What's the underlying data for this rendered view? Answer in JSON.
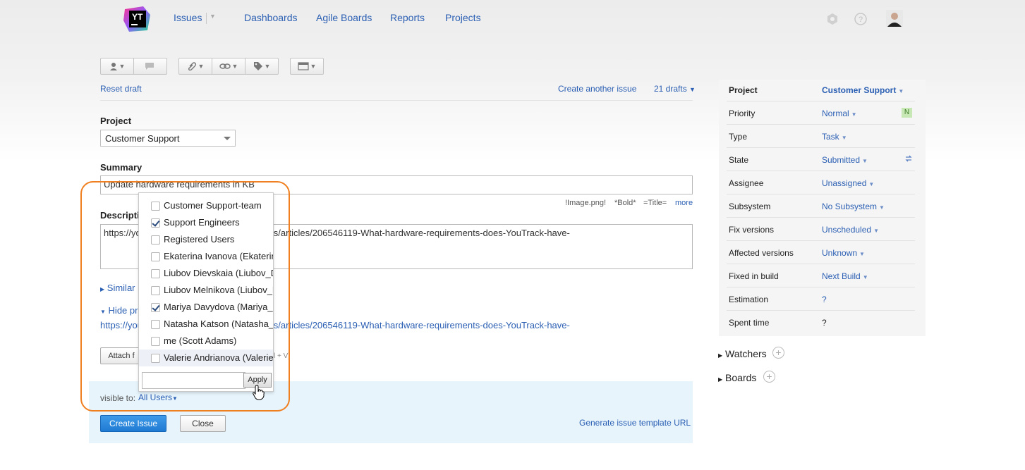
{
  "nav": {
    "logo_text": "YT",
    "items": [
      "Issues",
      "Dashboards",
      "Agile Boards",
      "Reports",
      "Projects"
    ]
  },
  "toolbar": {
    "reset_draft": "Reset draft",
    "create_another": "Create another issue",
    "drafts": "21 drafts"
  },
  "form": {
    "project_label": "Project",
    "project_value": "Customer Support",
    "summary_label": "Summary",
    "summary_value": "Update hardware requirements in KB",
    "description_label": "Description",
    "description_value": "https://yo",
    "description_tail": "n-us/articles/206546119-What-hardware-requirements-does-YouTrack-have-",
    "hint_image": "!Image.png!",
    "hint_bold": "*Bold*",
    "hint_title": "=Title=",
    "hint_more": "more",
    "similar": "Similar i",
    "hide_preview": "Hide pre",
    "preview_link_start": "https://you",
    "preview_link_tail": "n-us/articles/206546119-What-hardware-requirements-does-YouTrack-have-",
    "attach_label": "Attach f",
    "attach_hint": "l + V)",
    "visible_to_label": "visible to:",
    "visible_to_value": "All Users",
    "create_issue": "Create Issue",
    "close": "Close",
    "template_url": "Generate issue template URL"
  },
  "visibility_popup": {
    "options": [
      {
        "label": "Customer Support-team",
        "checked": false
      },
      {
        "label": "Support Engineers",
        "checked": true
      },
      {
        "label": "Registered Users",
        "checked": false
      },
      {
        "label": "Ekaterina Ivanova (Ekaterin",
        "checked": false
      },
      {
        "label": "Liubov Dievskaia (Liubov_D",
        "checked": false
      },
      {
        "label": "Liubov Melnikova (Liubov_M",
        "checked": false
      },
      {
        "label": "Mariya Davydova (Mariya_",
        "checked": true
      },
      {
        "label": "Natasha Katson (Natasha_",
        "checked": false
      },
      {
        "label": "me (Scott Adams)",
        "checked": false
      },
      {
        "label": "Valerie Andrianova (Valerie",
        "checked": false
      }
    ],
    "apply": "Apply"
  },
  "fields": [
    {
      "name": "Project",
      "value": "Customer Support"
    },
    {
      "name": "Priority",
      "value": "Normal",
      "badge": "N"
    },
    {
      "name": "Type",
      "value": "Task"
    },
    {
      "name": "State",
      "value": "Submitted"
    },
    {
      "name": "Assignee",
      "value": "Unassigned"
    },
    {
      "name": "Subsystem",
      "value": "No Subsystem"
    },
    {
      "name": "Fix versions",
      "value": "Unscheduled"
    },
    {
      "name": "Affected versions",
      "value": "Unknown"
    },
    {
      "name": "Fixed in build",
      "value": "Next Build"
    },
    {
      "name": "Estimation",
      "value": "?"
    },
    {
      "name": "Spent time",
      "value": "?"
    }
  ],
  "sidebar": {
    "watchers": "Watchers",
    "boards": "Boards"
  },
  "colors": {
    "link": "#2b5fb3",
    "primary_button": "#1f7ad3",
    "highlight_ring": "#f07f1f",
    "bottom_panel": "#e7f4fc"
  }
}
